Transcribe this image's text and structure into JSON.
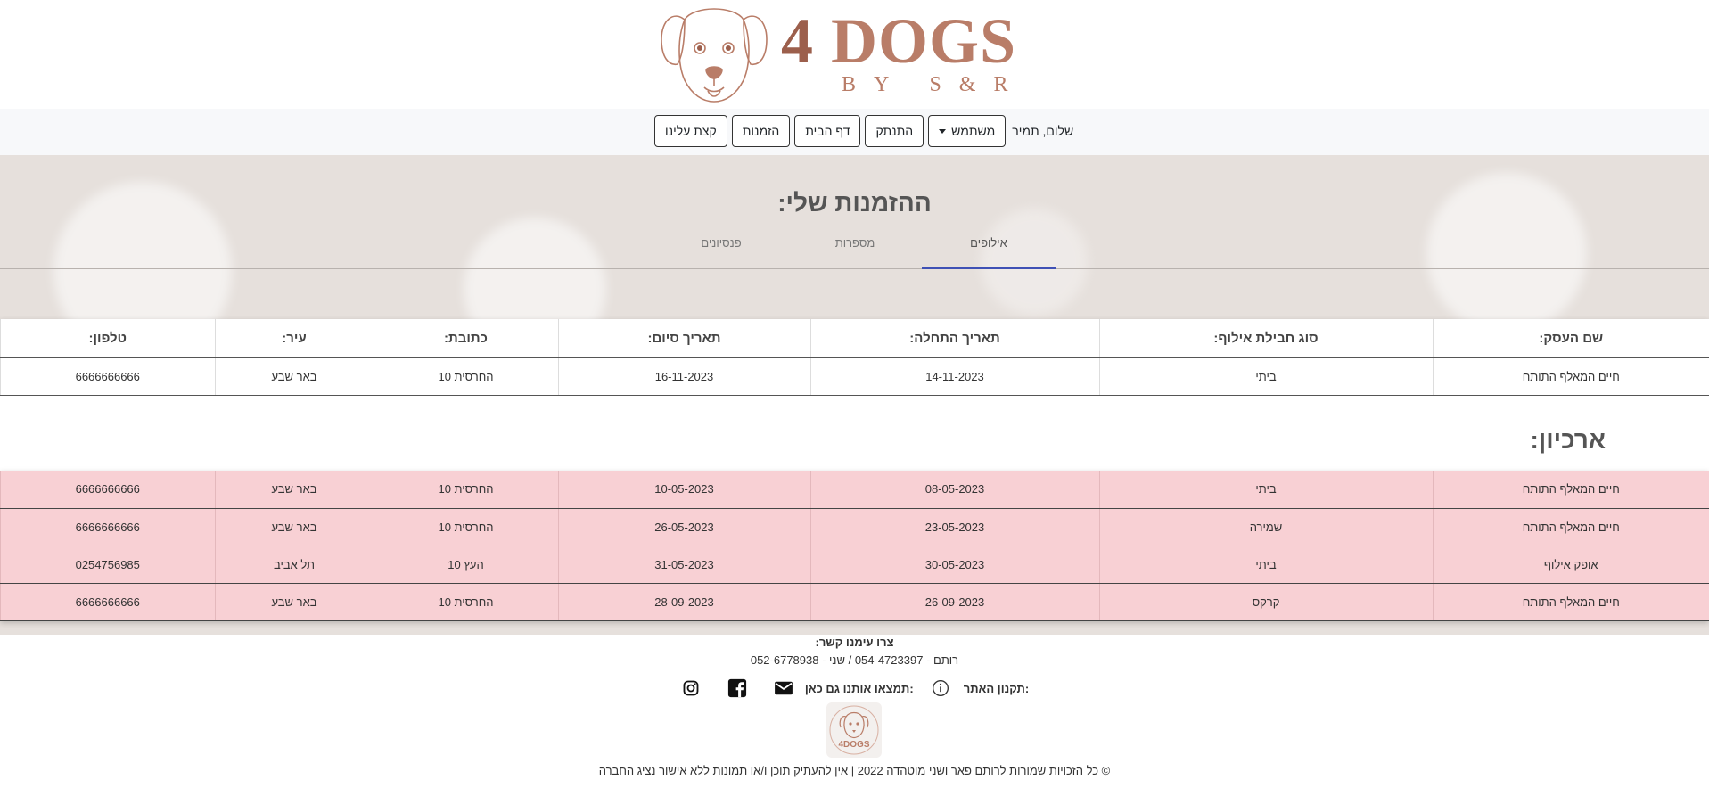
{
  "brand": {
    "main_number": "4",
    "main_word": "DOGS",
    "sub": "BY S&R"
  },
  "colors": {
    "brand": "#b97d68",
    "tab_active": "#3f51b5",
    "archive_row": "#f8d0d4"
  },
  "nav": {
    "greeting": "שלום, תמיר",
    "user_menu": "משתמש",
    "logout": "התנתק",
    "home": "דף הבית",
    "orders": "הזמנות",
    "about": "קצת עלינו"
  },
  "page": {
    "title": "ההזמנות שלי:",
    "tabs": [
      {
        "label": "אילופים",
        "active": true
      },
      {
        "label": "מספרות",
        "active": false
      },
      {
        "label": "פנסיונים",
        "active": false
      }
    ]
  },
  "table": {
    "headers": [
      "שם העסק:",
      "סוג חבילת אילוף:",
      "תאריך התחלה:",
      "תאריך סיום:",
      "כתובת:",
      "עיר:",
      "טלפון:"
    ],
    "current_rows": [
      [
        "חיים המאלף התותח",
        "ביתי",
        "14-11-2023",
        "16-11-2023",
        "החרסית 10",
        "באר שבע",
        "6666666666"
      ]
    ]
  },
  "archive": {
    "title": "ארכיון:",
    "rows": [
      [
        "חיים המאלף התותח",
        "ביתי",
        "08-05-2023",
        "10-05-2023",
        "החרסית 10",
        "באר שבע",
        "6666666666"
      ],
      [
        "חיים המאלף התותח",
        "שמירה",
        "23-05-2023",
        "26-05-2023",
        "החרסית 10",
        "באר שבע",
        "6666666666"
      ],
      [
        "אופק אילוף",
        "ביתי",
        "30-05-2023",
        "31-05-2023",
        "העץ 10",
        "תל אביב",
        "0254756985"
      ],
      [
        "חיים המאלף התותח",
        "קרקס",
        "26-09-2023",
        "28-09-2023",
        "החרסית 10",
        "באר שבע",
        "6666666666"
      ]
    ]
  },
  "footer": {
    "contact_title": "צרו עימנו קשר:",
    "contact": "רותם - 054-4723397 / שני - 052-6778938",
    "site_rules": "תקנון האתר:",
    "find_us": "תמצאו אותנו גם כאן:",
    "logo_text": "4DOGS",
    "copyright": "© כל הזכויות שמורות לרותם פאר ושני מוטהדה 2022 | אין להעתיק תוכן ו/או תמונות ללא אישור נציג החברה",
    "icons": [
      "info-icon",
      "email-icon",
      "facebook-icon",
      "instagram-icon"
    ]
  }
}
